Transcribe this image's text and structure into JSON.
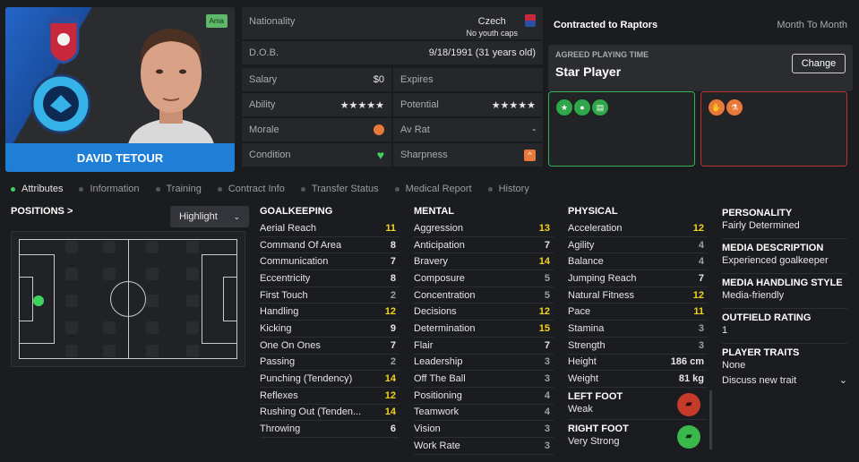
{
  "player": {
    "name": "DAVID TETOUR",
    "tag": "Ama"
  },
  "info": {
    "nationality_label": "Nationality",
    "nationality": "Czech",
    "caps": "No youth caps",
    "dob_label": "D.O.B.",
    "dob": "9/18/1991 (31 years old)",
    "salary_label": "Salary",
    "salary": "$0",
    "expires_label": "Expires",
    "expires": "",
    "ability_label": "Ability",
    "ability_stars": "★★★★★",
    "potential_label": "Potential",
    "potential_stars": "★★★★★",
    "morale_label": "Morale",
    "avrat_label": "Av Rat",
    "avrat": "-",
    "condition_label": "Condition",
    "sharpness_label": "Sharpness"
  },
  "contract": {
    "title": "Contracted to Raptors",
    "term": "Month To Month",
    "agreed_label": "AGREED PLAYING TIME",
    "agreed_value": "Star Player",
    "change_button": "Change"
  },
  "tabs": [
    "Attributes",
    "Information",
    "Training",
    "Contract Info",
    "Transfer Status",
    "Medical Report",
    "History"
  ],
  "positions": {
    "title": "POSITIONS >",
    "highlight": "Highlight"
  },
  "goalkeeping": {
    "title": "GOALKEEPING",
    "rows": [
      {
        "name": "Aerial Reach",
        "value": "11",
        "tone": "y"
      },
      {
        "name": "Command Of Area",
        "value": "8",
        "tone": "w"
      },
      {
        "name": "Communication",
        "value": "7",
        "tone": "w"
      },
      {
        "name": "Eccentricity",
        "value": "8",
        "tone": "w"
      },
      {
        "name": "First Touch",
        "value": "2",
        "tone": "g"
      },
      {
        "name": "Handling",
        "value": "12",
        "tone": "y"
      },
      {
        "name": "Kicking",
        "value": "9",
        "tone": "w"
      },
      {
        "name": "One On Ones",
        "value": "7",
        "tone": "w"
      },
      {
        "name": "Passing",
        "value": "2",
        "tone": "g"
      },
      {
        "name": "Punching (Tendency)",
        "value": "14",
        "tone": "y"
      },
      {
        "name": "Reflexes",
        "value": "12",
        "tone": "y"
      },
      {
        "name": "Rushing Out (Tenden...",
        "value": "14",
        "tone": "y"
      },
      {
        "name": "Throwing",
        "value": "6",
        "tone": "w"
      }
    ]
  },
  "mental": {
    "title": "MENTAL",
    "rows": [
      {
        "name": "Aggression",
        "value": "13",
        "tone": "y"
      },
      {
        "name": "Anticipation",
        "value": "7",
        "tone": "w"
      },
      {
        "name": "Bravery",
        "value": "14",
        "tone": "y"
      },
      {
        "name": "Composure",
        "value": "5",
        "tone": "g"
      },
      {
        "name": "Concentration",
        "value": "5",
        "tone": "g"
      },
      {
        "name": "Decisions",
        "value": "12",
        "tone": "y"
      },
      {
        "name": "Determination",
        "value": "15",
        "tone": "y"
      },
      {
        "name": "Flair",
        "value": "7",
        "tone": "w"
      },
      {
        "name": "Leadership",
        "value": "3",
        "tone": "g"
      },
      {
        "name": "Off The Ball",
        "value": "3",
        "tone": "g"
      },
      {
        "name": "Positioning",
        "value": "4",
        "tone": "g"
      },
      {
        "name": "Teamwork",
        "value": "4",
        "tone": "g"
      },
      {
        "name": "Vision",
        "value": "3",
        "tone": "g"
      },
      {
        "name": "Work Rate",
        "value": "3",
        "tone": "g"
      }
    ]
  },
  "physical": {
    "title": "PHYSICAL",
    "rows": [
      {
        "name": "Acceleration",
        "value": "12",
        "tone": "y"
      },
      {
        "name": "Agility",
        "value": "4",
        "tone": "g"
      },
      {
        "name": "Balance",
        "value": "4",
        "tone": "g"
      },
      {
        "name": "Jumping Reach",
        "value": "7",
        "tone": "w"
      },
      {
        "name": "Natural Fitness",
        "value": "12",
        "tone": "y"
      },
      {
        "name": "Pace",
        "value": "11",
        "tone": "y"
      },
      {
        "name": "Stamina",
        "value": "3",
        "tone": "g"
      },
      {
        "name": "Strength",
        "value": "3",
        "tone": "g"
      },
      {
        "name": "Height",
        "value": "186 cm",
        "tone": "w"
      },
      {
        "name": "Weight",
        "value": "81 kg",
        "tone": "w"
      }
    ],
    "left_foot_label": "LEFT FOOT",
    "left_foot": "Weak",
    "right_foot_label": "RIGHT FOOT",
    "right_foot": "Very Strong"
  },
  "side": {
    "personality_label": "PERSONALITY",
    "personality": "Fairly Determined",
    "media_desc_label": "MEDIA DESCRIPTION",
    "media_desc": "Experienced goalkeeper",
    "media_style_label": "MEDIA HANDLING STYLE",
    "media_style": "Media-friendly",
    "outfield_label": "OUTFIELD RATING",
    "outfield": "1",
    "traits_label": "PLAYER TRAITS",
    "traits": "None",
    "discuss": "Discuss new trait"
  },
  "colors": {
    "accent": "#1f7fd6",
    "highlight": "#f4d31d",
    "positive": "#3dd35e",
    "negative": "#d13a2f"
  }
}
